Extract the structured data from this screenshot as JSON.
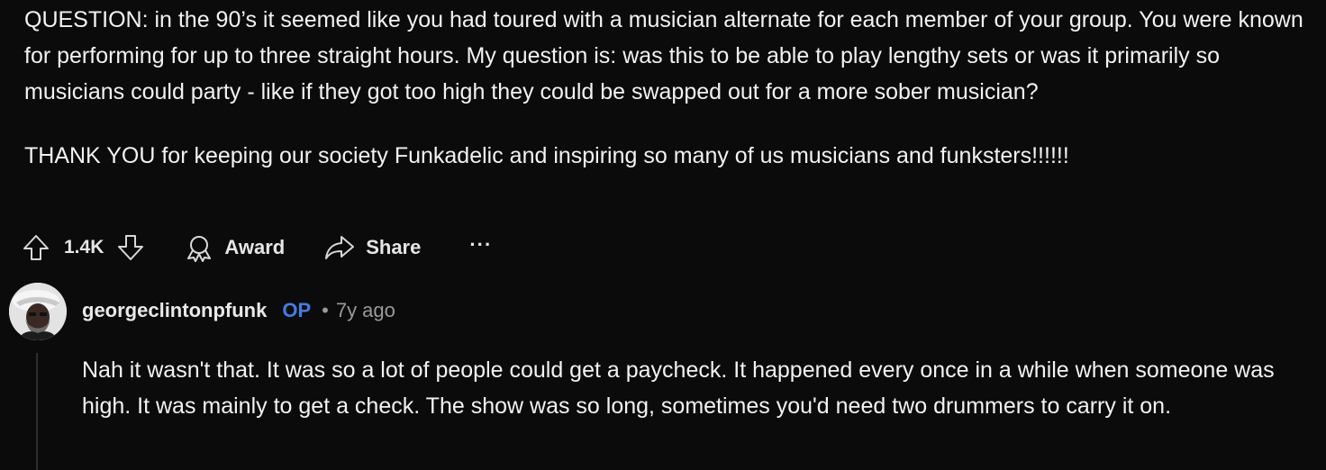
{
  "post": {
    "question_paragraph": "QUESTION: in the 90’s it seemed like you had toured with a musician alternate for each member of your group. You were known for performing for up to three straight hours. My question is: was this to be able to play lengthy sets or was it primarily so musicians could party - like if they got too high they could be swapped out for a more sober musician?",
    "thanks_paragraph": "THANK YOU for keeping our society Funkadelic and inspiring so many of us musicians and funksters!!!!!!"
  },
  "actions": {
    "score": "1.4K",
    "award_label": "Award",
    "share_label": "Share",
    "more_label": "···"
  },
  "reply": {
    "author": "georgeclintonpfunk",
    "op_badge": "OP",
    "separator": "•",
    "time": "7y ago",
    "body": "Nah it wasn't that. It was so a lot of people could get a paycheck. It happened every once in a while when someone was high. It was mainly to get a check. The show was so long, sometimes you'd need two drummers to carry it on."
  },
  "colors": {
    "background": "#0b0b0b",
    "text": "#f2f2f2",
    "op_badge": "#3d7fe6",
    "muted": "#9a9a9a"
  },
  "icons": [
    "upvote-icon",
    "downvote-icon",
    "award-icon",
    "share-icon",
    "more-icon"
  ]
}
